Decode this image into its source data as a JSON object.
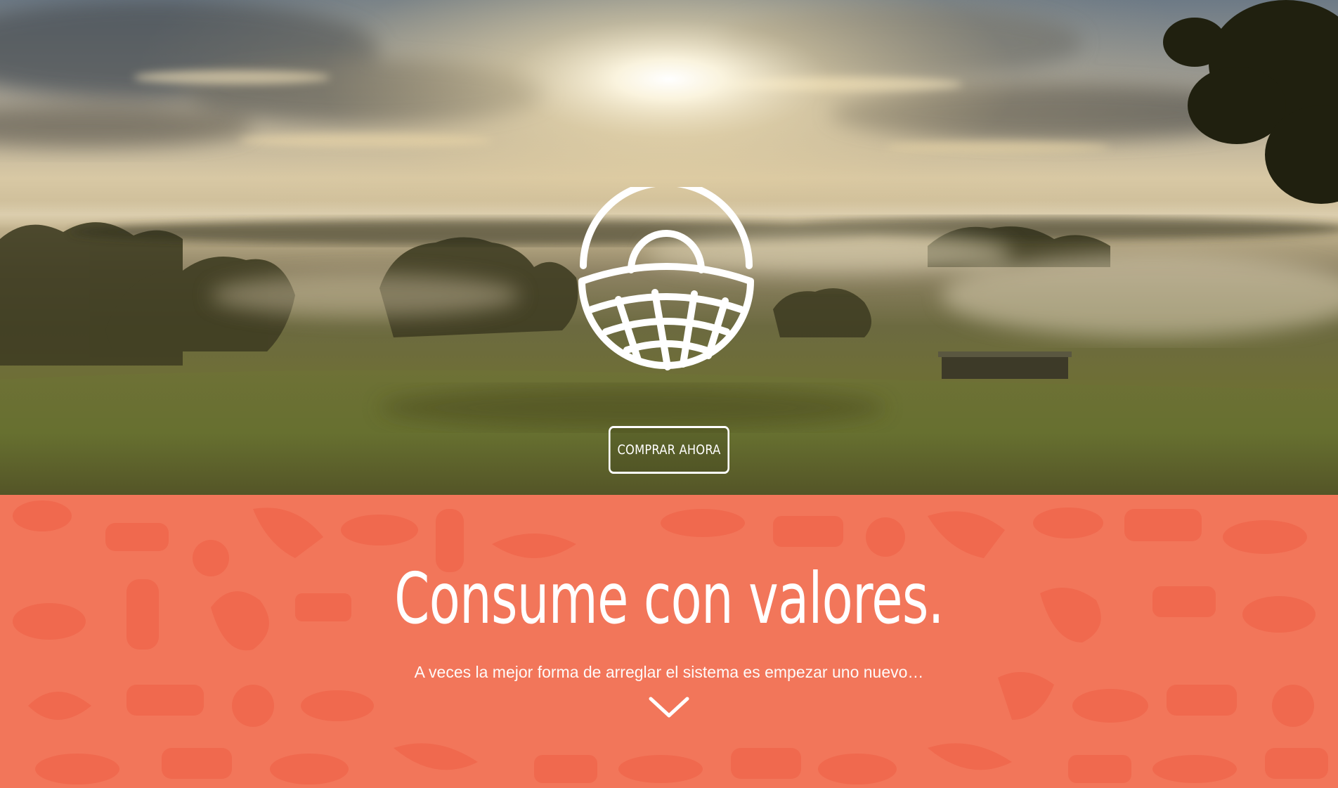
{
  "hero": {
    "cta_label": "COMPRAR AHORA",
    "logo_icon": "basket-icon"
  },
  "values": {
    "title": "Consume con valores.",
    "subtitle": "A veces la mejor forma de arreglar el sistema es empezar uno nuevo…",
    "scroll_icon": "chevron-down-icon"
  },
  "colors": {
    "accent": "#f2765a",
    "pattern": "#f0694e",
    "text": "#ffffff"
  }
}
